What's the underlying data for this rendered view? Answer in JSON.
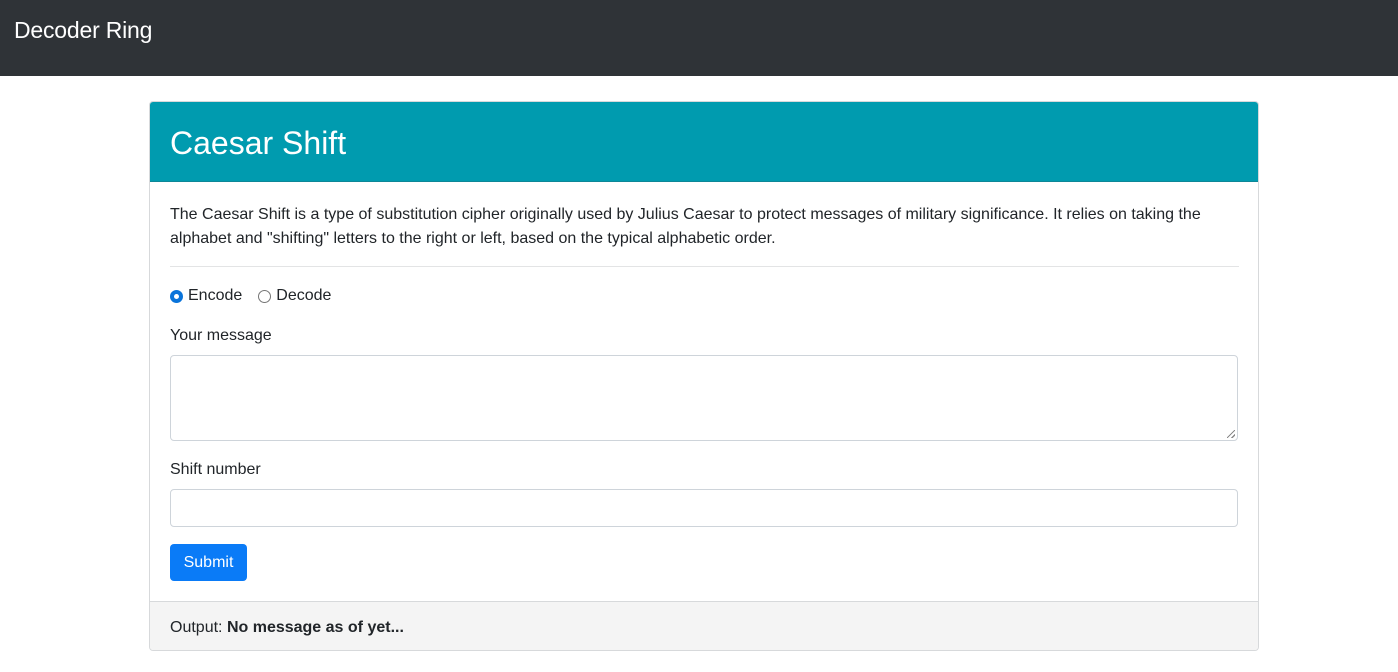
{
  "navbar": {
    "brand": "Decoder Ring"
  },
  "card": {
    "title": "Caesar Shift",
    "description": "The Caesar Shift is a type of substitution cipher originally used by Julius Caesar to protect messages of military significance. It relies on taking the alphabet and \"shifting\" letters to the right or left, based on the typical alphabetic order.",
    "mode": {
      "options": [
        {
          "label": "Encode",
          "checked": true
        },
        {
          "label": "Decode",
          "checked": false
        }
      ]
    },
    "message": {
      "label": "Your message",
      "value": ""
    },
    "shift": {
      "label": "Shift number",
      "value": ""
    },
    "submit_label": "Submit",
    "output": {
      "label": "Output:",
      "value": "No message as of yet..."
    }
  },
  "colors": {
    "navbar_bg": "#2f3337",
    "header_bg": "#009baf",
    "button_bg": "#0a7bf7",
    "footer_bg": "#f4f4f4"
  }
}
